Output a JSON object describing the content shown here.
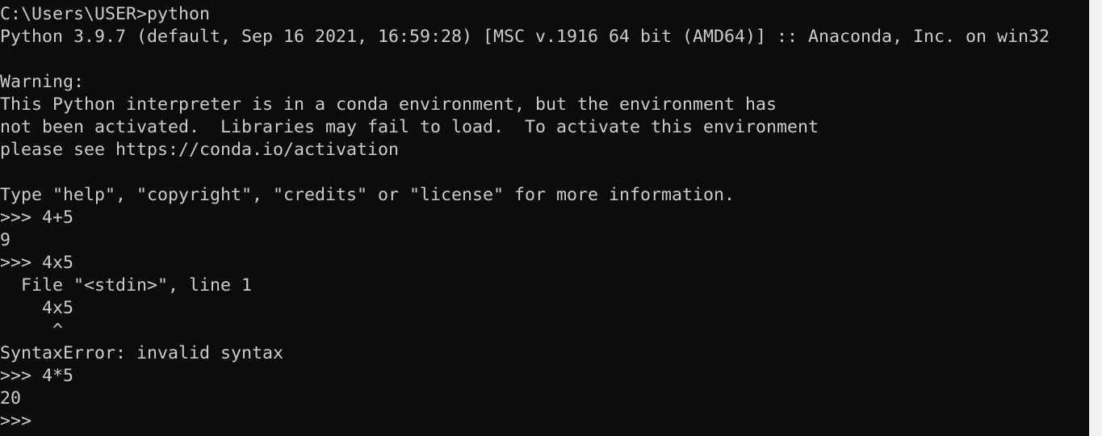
{
  "console": {
    "lines": [
      "C:\\Users\\USER>python",
      "Python 3.9.7 (default, Sep 16 2021, 16:59:28) [MSC v.1916 64 bit (AMD64)] :: Anaconda, Inc. on win32",
      "",
      "Warning:",
      "This Python interpreter is in a conda environment, but the environment has",
      "not been activated.  Libraries may fail to load.  To activate this environment",
      "please see https://conda.io/activation",
      "",
      "Type \"help\", \"copyright\", \"credits\" or \"license\" for more information.",
      ">>> 4+5",
      "9",
      ">>> 4x5",
      "  File \"<stdin>\", line 1",
      "    4x5",
      "     ^",
      "SyntaxError: invalid syntax",
      ">>> 4*5",
      "20",
      ">>> "
    ]
  },
  "colors": {
    "background": "#0c0c0c",
    "text": "#cccccc",
    "scrollbar": "#f2f2f2"
  }
}
